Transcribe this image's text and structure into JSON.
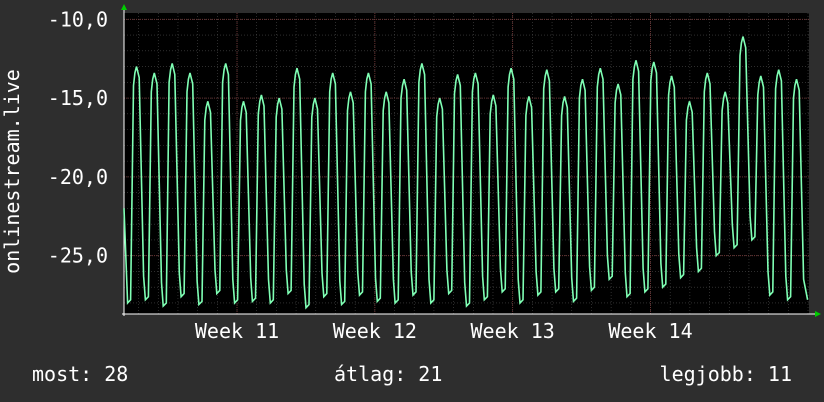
{
  "colors": {
    "background": "#2e2e2e",
    "plot_background": "#000000",
    "grid": "#4a4a4a",
    "line": "#7fffb4",
    "text": "#ffffff",
    "axis_arrow": "#00cc00"
  },
  "chart_data": {
    "type": "line",
    "ylabel": "onlinestream.live",
    "ylim": [
      -28.7,
      -9.6
    ],
    "yticks": [
      -10,
      -15,
      -20,
      -25
    ],
    "ytick_labels": [
      "-10,0",
      "-15,0",
      "-20,0",
      "-25,0"
    ],
    "xlim": [
      10.18,
      15.15
    ],
    "xticks": [
      11,
      12,
      13,
      14
    ],
    "xtick_labels": [
      "Week 11",
      "Week 12",
      "Week 13",
      "Week 14"
    ],
    "grid": true,
    "legend": "none",
    "peaks": [
      -13.4,
      -13.8,
      -13.2,
      -13.8,
      -15.6,
      -13.2,
      -15.6,
      -15.2,
      -15.4,
      -13.5,
      -15.4,
      -13.8,
      -15.0,
      -13.8,
      -15.0,
      -14.2,
      -13.2,
      -15.4,
      -13.9,
      -13.8,
      -15.2,
      -13.5,
      -15.3,
      -13.6,
      -15.3,
      -14.2,
      -13.5,
      -14.5,
      -13.0,
      -13.1,
      -14.0,
      -15.6,
      -13.8,
      -15.0,
      -11.5,
      -14.0,
      -13.6,
      -14.2
    ],
    "troughs": [
      -28.0,
      -27.8,
      -28.2,
      -27.6,
      -28.1,
      -27.4,
      -28.0,
      -27.9,
      -28.0,
      -27.4,
      -28.3,
      -27.6,
      -28.1,
      -27.5,
      -27.9,
      -28.0,
      -27.5,
      -28.0,
      -27.4,
      -28.2,
      -27.8,
      -27.3,
      -28.0,
      -27.5,
      -27.3,
      -27.9,
      -27.2,
      -26.5,
      -27.6,
      -27.3,
      -27.0,
      -26.4,
      -26.0,
      -25.0,
      -24.5,
      -24.0,
      -27.5,
      -27.8
    ],
    "series": [
      {
        "values_desc": "oscillating daily temperature-like signal"
      }
    ]
  },
  "stats": {
    "current": "most: 28",
    "average": "átlag: 21",
    "best": "legjobb: 11"
  }
}
